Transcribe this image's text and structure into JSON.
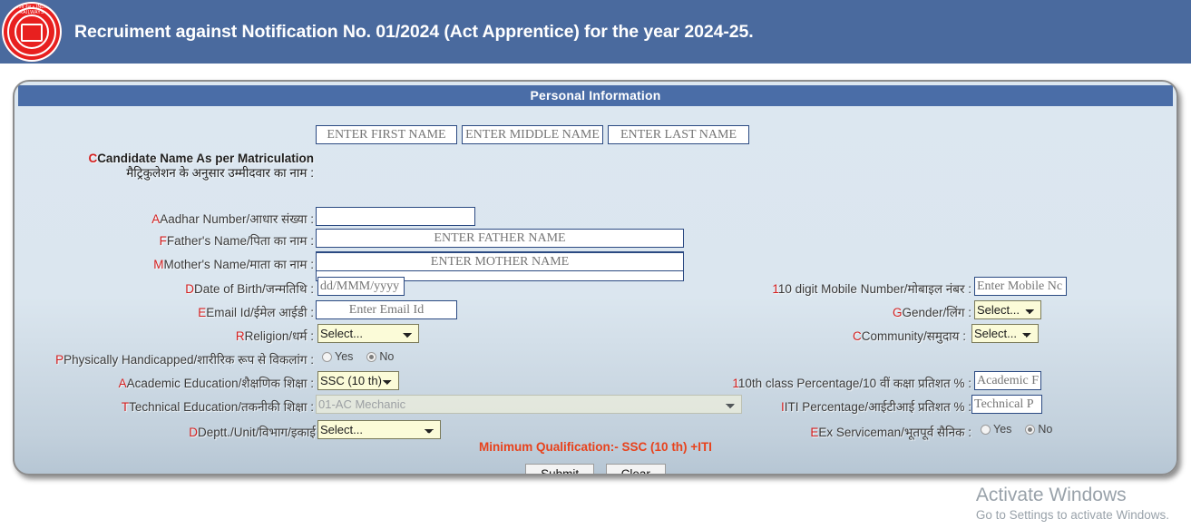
{
  "header": {
    "title": "Recruiment against Notification No. 01/2024 (Act Apprentice) for the year 2024-25.",
    "logo_top_text": "भारतीय रेल • INDIAN RAILWAYS",
    "logo_bottom_text": "",
    "bg_color": "#4a6a9e"
  },
  "section": {
    "title": "Personal Information",
    "title_bar_color": "#4a6da7"
  },
  "name_fields": {
    "first_placeholder": "ENTER FIRST NAME",
    "middle_placeholder": "ENTER MIDDLE NAME",
    "last_placeholder": "ENTER LAST NAME"
  },
  "left_column": {
    "candidate_name_label_en": "Candidate Name As per Matriculation",
    "candidate_name_label_hi": "मैट्रिकुलेशन के अनुसार उम्मीदवार का नाम :",
    "candidate_name_value": "",
    "aadhar_label": "Aadhar Number/आधार संख्या :",
    "aadhar_value": "",
    "father_label": "Father's Name/पिता का नाम :",
    "father_placeholder": "ENTER FATHER NAME",
    "mother_label": "Mother's Name/माता का नाम :",
    "mother_placeholder": "ENTER MOTHER NAME",
    "dob_label": "Date of Birth/जन्मतिथि :",
    "dob_placeholder": "dd/MMM/yyyy",
    "email_label": "Email Id/ईमेल आईडी :",
    "email_placeholder": "Enter Email Id",
    "religion_label": "Religion/धर्म :",
    "religion_value": "Select...",
    "ph_label": "Physically Handicapped/शारीरिक रूप से विकलांग :",
    "ph_yes": "Yes",
    "ph_no": "No",
    "ph_selected": "No",
    "academic_label": "Academic Education/शैक्षणिक शिक्षा :",
    "academic_value": "SSC (10 th)",
    "technical_label": "Technical Education/तकनीकी शिक्षा :",
    "technical_value": "01-AC Mechanic",
    "technical_disabled": true,
    "deptt_label": "Deptt./Unit/विभाग/इकाई",
    "deptt_value": "Select..."
  },
  "right_column": {
    "mobile_label": "10 digit Mobile Number/मोबाइल नंबर :",
    "mobile_placeholder": "Enter Mobile Nc",
    "gender_label": "Gender/लिंग :",
    "gender_value": "Select...",
    "community_label": "Community/समुदाय :",
    "community_value": "Select...",
    "tenth_pct_label": "10th class Percentage/10 वीं कक्षा प्रतिशत % :",
    "tenth_pct_placeholder": "Academic F",
    "iti_pct_label": "ITI Percentage/आईटीआई प्रतिशत % :",
    "iti_pct_placeholder": "Technical P",
    "ex_service_label": "Ex Serviceman/भूतपूर्व सैनिक :",
    "ex_service_yes": "Yes",
    "ex_service_no": "No",
    "ex_service_selected": "No"
  },
  "footer": {
    "min_qualification": "Minimum Qualification:- SSC (10 th) +ITI",
    "min_qualification_color": "#e8421c",
    "submit_label": "Submit",
    "clear_label": "Clear"
  },
  "watermark": {
    "line1": "Activate Windows",
    "line2": "Go to Settings to activate Windows."
  }
}
